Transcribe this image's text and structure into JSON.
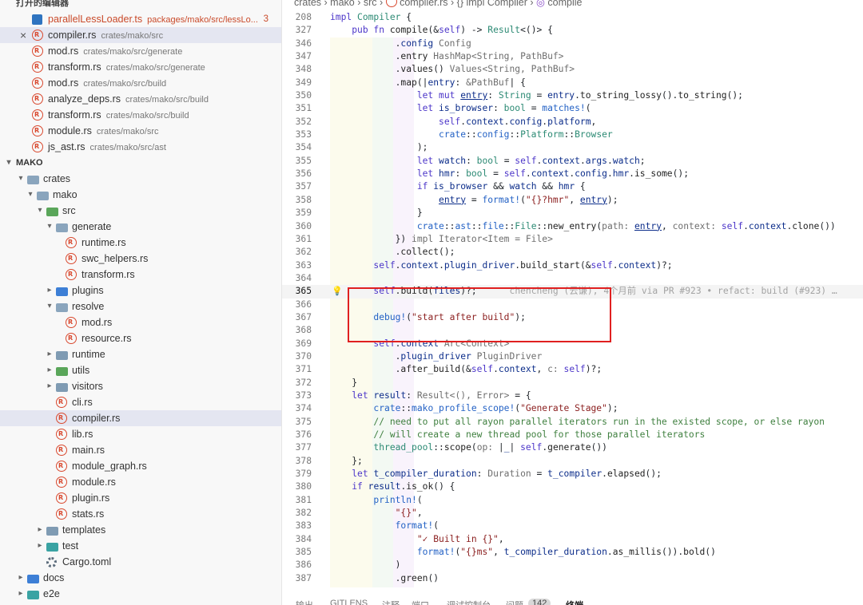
{
  "open_editors": {
    "header": "打开的编辑器",
    "items": [
      {
        "name": "parallelLessLoader.ts",
        "path": "packages/mako/src/lessLo...",
        "badge": "3",
        "icon": "typescript-icon",
        "modified": true
      },
      {
        "name": "compiler.rs",
        "path": "crates/mako/src",
        "icon": "rust-icon",
        "active": true,
        "close": "×"
      },
      {
        "name": "mod.rs",
        "path": "crates/mako/src/generate",
        "icon": "rust-icon"
      },
      {
        "name": "transform.rs",
        "path": "crates/mako/src/generate",
        "icon": "rust-icon"
      },
      {
        "name": "mod.rs",
        "path": "crates/mako/src/build",
        "icon": "rust-icon"
      },
      {
        "name": "analyze_deps.rs",
        "path": "crates/mako/src/build",
        "icon": "rust-icon"
      },
      {
        "name": "transform.rs",
        "path": "crates/mako/src/build",
        "icon": "rust-icon"
      },
      {
        "name": "module.rs",
        "path": "crates/mako/src",
        "icon": "rust-icon"
      },
      {
        "name": "js_ast.rs",
        "path": "crates/mako/src/ast",
        "icon": "rust-icon"
      }
    ]
  },
  "explorer": {
    "section": "MAKO",
    "tree": [
      {
        "label": "crates",
        "depth": 1,
        "type": "folder",
        "open": true
      },
      {
        "label": "mako",
        "depth": 2,
        "type": "folder",
        "open": true
      },
      {
        "label": "src",
        "depth": 3,
        "type": "folder-green",
        "open": true
      },
      {
        "label": "generate",
        "depth": 4,
        "type": "folder",
        "open": true
      },
      {
        "label": "runtime.rs",
        "depth": 5,
        "type": "rust"
      },
      {
        "label": "swc_helpers.rs",
        "depth": 5,
        "type": "rust"
      },
      {
        "label": "transform.rs",
        "depth": 5,
        "type": "rust"
      },
      {
        "label": "plugins",
        "depth": 4,
        "type": "folder-blue",
        "open": false
      },
      {
        "label": "resolve",
        "depth": 4,
        "type": "folder",
        "open": true
      },
      {
        "label": "mod.rs",
        "depth": 5,
        "type": "rust"
      },
      {
        "label": "resource.rs",
        "depth": 5,
        "type": "rust"
      },
      {
        "label": "runtime",
        "depth": 4,
        "type": "folder",
        "open": false
      },
      {
        "label": "utils",
        "depth": 4,
        "type": "folder-green",
        "open": false
      },
      {
        "label": "visitors",
        "depth": 4,
        "type": "folder",
        "open": false
      },
      {
        "label": "cli.rs",
        "depth": 4,
        "type": "rust"
      },
      {
        "label": "compiler.rs",
        "depth": 4,
        "type": "rust",
        "active": true
      },
      {
        "label": "lib.rs",
        "depth": 4,
        "type": "rust"
      },
      {
        "label": "main.rs",
        "depth": 4,
        "type": "rust"
      },
      {
        "label": "module_graph.rs",
        "depth": 4,
        "type": "rust"
      },
      {
        "label": "module.rs",
        "depth": 4,
        "type": "rust"
      },
      {
        "label": "plugin.rs",
        "depth": 4,
        "type": "rust"
      },
      {
        "label": "stats.rs",
        "depth": 4,
        "type": "rust"
      },
      {
        "label": "templates",
        "depth": 3,
        "type": "folder",
        "open": false
      },
      {
        "label": "test",
        "depth": 3,
        "type": "folder-teal",
        "open": false
      },
      {
        "label": "Cargo.toml",
        "depth": 3,
        "type": "gear"
      },
      {
        "label": "docs",
        "depth": 1,
        "type": "folder-blue",
        "open": false
      },
      {
        "label": "e2e",
        "depth": 1,
        "type": "folder-teal",
        "open": false
      }
    ]
  },
  "breadcrumbs": [
    "crates",
    "mako",
    "src",
    "compiler.rs",
    "{} impl Compiler",
    "compile"
  ],
  "editor": {
    "sticky": [
      {
        "n": "208",
        "html": "<span class=\"kw\">impl</span> <span class=\"ty\">Compiler</span> {"
      },
      {
        "n": "327",
        "html": "    <span class=\"kw\">pub fn</span> <span class=\"fn\">compile</span>(&amp;<span class=\"kw\">self</span>) -&gt; <span class=\"ty\">Result</span>&lt;()&gt; {"
      }
    ],
    "lines": [
      {
        "n": "346",
        "html": "            .<span class=\"var\">config</span> <span class=\"hint\">Config</span>"
      },
      {
        "n": "347",
        "html": "            .<span class=\"fn\">entry</span> <span class=\"hint\">HashMap&lt;String, PathBuf&gt;</span>"
      },
      {
        "n": "348",
        "html": "            .<span class=\"fn\">values</span>() <span class=\"hint\">Values&lt;String, PathBuf&gt;</span>"
      },
      {
        "n": "349",
        "html": "            .<span class=\"fn\">map</span>(|<span class=\"var\">entry</span>: <span class=\"hint\">&amp;PathBuf</span>| {"
      },
      {
        "n": "350",
        "html": "                <span class=\"kw\">let mut</span> <span class=\"vu\">entry</span>: <span class=\"ty\">String</span> = <span class=\"var\">entry</span>.<span class=\"fn\">to_string_lossy</span>().<span class=\"fn\">to_string</span>();"
      },
      {
        "n": "351",
        "html": "                <span class=\"kw\">let</span> <span class=\"var\">is_browser</span>: <span class=\"ty\">bool</span> = <span class=\"mac\">matches!</span>("
      },
      {
        "n": "352",
        "html": "                    <span class=\"kw\">self</span>.<span class=\"var\">context</span>.<span class=\"var\">config</span>.<span class=\"var\">platform</span>,"
      },
      {
        "n": "353",
        "html": "                    <span class=\"mac\">crate</span>::<span class=\"mac\">config</span>::<span class=\"ty\">Platform</span>::<span class=\"ty\">Browser</span>"
      },
      {
        "n": "354",
        "html": "                );"
      },
      {
        "n": "355",
        "html": "                <span class=\"kw\">let</span> <span class=\"var\">watch</span>: <span class=\"ty\">bool</span> = <span class=\"kw\">self</span>.<span class=\"var\">context</span>.<span class=\"var\">args</span>.<span class=\"var\">watch</span>;"
      },
      {
        "n": "356",
        "html": "                <span class=\"kw\">let</span> <span class=\"var\">hmr</span>: <span class=\"ty\">bool</span> = <span class=\"kw\">self</span>.<span class=\"var\">context</span>.<span class=\"var\">config</span>.<span class=\"var\">hmr</span>.<span class=\"fn\">is_some</span>();"
      },
      {
        "n": "357",
        "html": "                <span class=\"kw\">if</span> <span class=\"var\">is_browser</span> &amp;&amp; <span class=\"var\">watch</span> &amp;&amp; <span class=\"var\">hmr</span> {"
      },
      {
        "n": "358",
        "html": "                    <span class=\"vu\">entry</span> = <span class=\"mac\">format!</span>(<span class=\"str\">\"{}?hmr\"</span>, <span class=\"vu\">entry</span>);"
      },
      {
        "n": "359",
        "html": "                }"
      },
      {
        "n": "360",
        "html": "                <span class=\"mac\">crate</span>::<span class=\"mac\">ast</span>::<span class=\"mac\">file</span>::<span class=\"ty\">File</span>::<span class=\"fn\">new_entry</span>(<span class=\"hint\">path:</span> <span class=\"vu\">entry</span>, <span class=\"hint\">context:</span> <span class=\"kw\">self</span>.<span class=\"var\">context</span>.<span class=\"fn\">clone</span>())"
      },
      {
        "n": "361",
        "html": "            }) <span class=\"hint\">impl Iterator&lt;Item = File&gt;</span>"
      },
      {
        "n": "362",
        "html": "            .<span class=\"fn\">collect</span>();"
      },
      {
        "n": "363",
        "html": "        <span class=\"kw\">self</span>.<span class=\"var\">context</span>.<span class=\"var\">plugin_driver</span>.<span class=\"fn\">build_start</span>(&amp;<span class=\"kw\">self</span>.<span class=\"var\">context</span>)?;"
      },
      {
        "n": "364",
        "html": ""
      },
      {
        "n": "365",
        "html": "        <span class=\"kw\">self</span>.<span class=\"fn\">build</span>(<span class=\"var\">files</span>)?;      <span class=\"blame\">chencheng (云谦), 4个月前 via PR #923 • refact: build (#923) …</span>",
        "current": true,
        "bulb": true
      },
      {
        "n": "366",
        "html": ""
      },
      {
        "n": "367",
        "html": "        <span class=\"mac\">debug!</span>(<span class=\"str\">\"start after build\"</span>);"
      },
      {
        "n": "368",
        "html": ""
      },
      {
        "n": "369",
        "html": "        <span class=\"kw\">self</span>.<span class=\"var\">context</span> <span class=\"hint\">Arc&lt;Context&gt;</span>"
      },
      {
        "n": "370",
        "html": "            .<span class=\"var\">plugin_driver</span> <span class=\"hint\">PluginDriver</span>"
      },
      {
        "n": "371",
        "html": "            .<span class=\"fn\">after_build</span>(&amp;<span class=\"kw\">self</span>.<span class=\"var\">context</span>, <span class=\"hint\">c:</span> <span class=\"kw\">self</span>)?;"
      },
      {
        "n": "372",
        "html": "    }"
      },
      {
        "n": "373",
        "html": "    <span class=\"kw\">let</span> <span class=\"var\">result</span>: <span class=\"hint\">Result&lt;(), Error&gt;</span> = {"
      },
      {
        "n": "374",
        "html": "        <span class=\"mac\">crate</span>::<span class=\"mac\">mako_profile_scope!</span>(<span class=\"str\">\"Generate Stage\"</span>);"
      },
      {
        "n": "375",
        "html": "        <span class=\"cm\">// need to put all rayon parallel iterators run in the existed scope, or else rayon</span>"
      },
      {
        "n": "376",
        "html": "        <span class=\"cm\">// will create a new thread pool for those parallel iterators</span>"
      },
      {
        "n": "377",
        "html": "        <span class=\"ty\">thread_pool</span>::<span class=\"fn\">scope</span>(<span class=\"hint\">op:</span> |<span class=\"var\">_</span>| <span class=\"kw\">self</span>.<span class=\"fn\">generate</span>())"
      },
      {
        "n": "378",
        "html": "    };"
      },
      {
        "n": "379",
        "html": "    <span class=\"kw\">let</span> <span class=\"var\">t_compiler_duration</span>: <span class=\"hint\">Duration</span> = <span class=\"var\">t_compiler</span>.<span class=\"fn\">elapsed</span>();"
      },
      {
        "n": "380",
        "html": "    <span class=\"kw\">if</span> <span class=\"var\">result</span>.<span class=\"fn\">is_ok</span>() {"
      },
      {
        "n": "381",
        "html": "        <span class=\"mac\">println!</span>("
      },
      {
        "n": "382",
        "html": "            <span class=\"str\">\"{}\"</span>,"
      },
      {
        "n": "383",
        "html": "            <span class=\"mac\">format!</span>("
      },
      {
        "n": "384",
        "html": "                <span class=\"str\">\"✓ Built in {}\"</span>,"
      },
      {
        "n": "385",
        "html": "                <span class=\"mac\">format!</span>(<span class=\"str\">\"{}ms\"</span>, <span class=\"var\">t_compiler_duration</span>.<span class=\"fn\">as_millis</span>()).<span class=\"fn\">bold</span>()"
      },
      {
        "n": "386",
        "html": "            )"
      },
      {
        "n": "387",
        "html": "            .<span class=\"fn\">green</span>()"
      }
    ]
  },
  "panel_tabs": [
    {
      "label": "输出"
    },
    {
      "label": "GITLENS"
    },
    {
      "label": "注释"
    },
    {
      "label": "端口"
    },
    {
      "label": "调试控制台"
    },
    {
      "label": "问题",
      "count": "142"
    },
    {
      "label": "终端",
      "active": true
    }
  ],
  "colors": {
    "highlight_box": "#e02020",
    "rust_icon": "#d9492f",
    "modified_file": "#c94a2a"
  }
}
